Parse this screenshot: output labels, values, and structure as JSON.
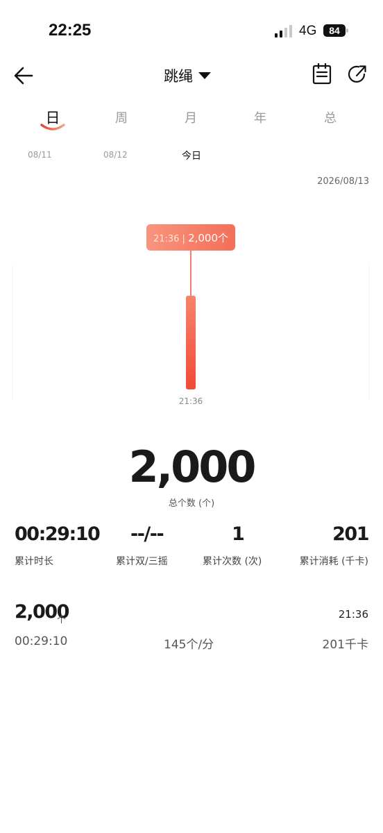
{
  "status_bar": {
    "time": "22:25",
    "network": "4G",
    "battery": "84"
  },
  "nav": {
    "title": "跳绳"
  },
  "tabs": [
    {
      "label": "日",
      "active": true
    },
    {
      "label": "周",
      "active": false
    },
    {
      "label": "月",
      "active": false
    },
    {
      "label": "年",
      "active": false
    },
    {
      "label": "总",
      "active": false
    }
  ],
  "dates": {
    "d1": "08/11",
    "d2": "08/12",
    "today": "今日",
    "full": "2026/08/13"
  },
  "chart_data": {
    "type": "bar",
    "categories": [
      "21:36"
    ],
    "values": [
      2000
    ],
    "tooltip": {
      "time": "21:36",
      "value": "2,000",
      "unit": "个"
    },
    "x_tick_labels": [
      "21:36"
    ],
    "colors": {
      "bar": "#f25a45",
      "tooltip": "#f7826e"
    }
  },
  "summary": {
    "total": "2,000",
    "total_label": "总个数 (个)"
  },
  "stats": [
    {
      "value": "00:29:10",
      "label": "累计时长"
    },
    {
      "value": "--/--",
      "label": "累计双/三摇"
    },
    {
      "value": "1",
      "label": "累计次数 (次)"
    },
    {
      "value": "201",
      "label": "累计消耗 (千卡)"
    }
  ],
  "record": {
    "count": "2,000",
    "unit": "个",
    "time": "21:36",
    "duration": "00:29:10",
    "rate": "145个/分",
    "calories": "201千卡"
  },
  "colors": {
    "accent": "#f25a45",
    "text": "#1a1a1a",
    "muted": "#999999"
  }
}
